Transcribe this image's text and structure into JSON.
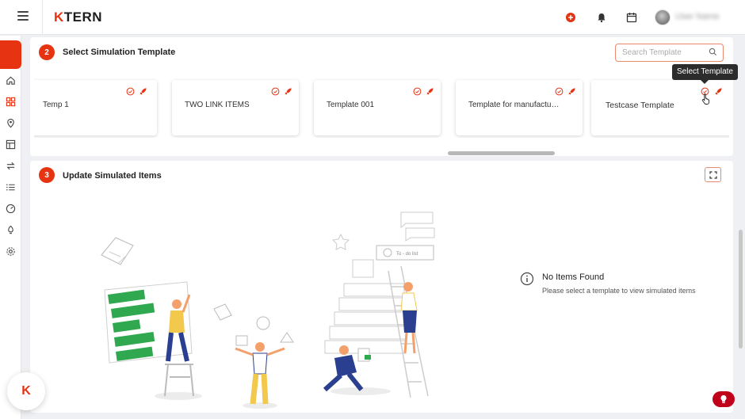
{
  "header": {
    "logo_k": "K",
    "logo_rest": "TERN",
    "username": "User Name"
  },
  "section1": {
    "step": "2",
    "title": "Select Simulation Template",
    "search_placeholder": "Search Template",
    "tooltip": "Select Template",
    "templates": [
      {
        "label": "Temp 1"
      },
      {
        "label": "TWO LINK ITEMS"
      },
      {
        "label": "Template 001"
      },
      {
        "label": "Template for manufacturi..."
      },
      {
        "label": "Testcase Template"
      }
    ]
  },
  "section2": {
    "step": "3",
    "title": "Update Simulated Items",
    "empty_title": "No Items Found",
    "empty_subtitle": "Please select a template to view simulated items",
    "illustration_todo": "To - do list"
  },
  "fab": {
    "label": "K"
  },
  "colors": {
    "accent": "#e63312",
    "green": "#2fa84f",
    "blue": "#2a3f8f",
    "yellow": "#f2c94c"
  }
}
